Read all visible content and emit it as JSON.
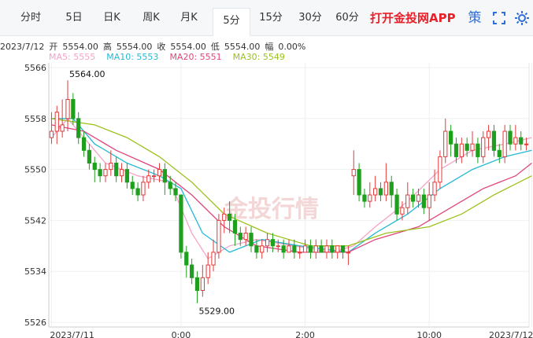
{
  "tabs": [
    {
      "label": "分时",
      "active": false
    },
    {
      "label": "5日",
      "active": false
    },
    {
      "label": "日K",
      "active": false
    },
    {
      "label": "周K",
      "active": false
    },
    {
      "label": "月K",
      "active": false
    },
    {
      "label": "5分",
      "active": true
    },
    {
      "label": "15分",
      "active": false
    },
    {
      "label": "30分",
      "active": false
    },
    {
      "label": "60分",
      "active": false
    }
  ],
  "app_cta": "打开金投网APP",
  "toolbar": {
    "strategy_label": "策",
    "icons": [
      "fullscreen-icon",
      "settings-icon"
    ]
  },
  "info": {
    "date": "2023/7/12",
    "open_label": "开",
    "open": "5554.00",
    "high_label": "高",
    "high": "5554.00",
    "close_label": "收",
    "close": "5554.00",
    "low_label": "低",
    "low": "5554.00",
    "amp_label": "幅",
    "amp": "0.00%"
  },
  "ma_legend": [
    {
      "label": "MA5:",
      "value": "5555",
      "color": "#f5a3c7"
    },
    {
      "label": "MA10:",
      "value": "5553",
      "color": "#25b9d4"
    },
    {
      "label": "MA20:",
      "value": "5551",
      "color": "#e0457b"
    },
    {
      "label": "MA30:",
      "value": "5549",
      "color": "#9bc21c"
    }
  ],
  "watermark": "金投行情",
  "chart_data": {
    "type": "candlestick",
    "y_ticks": [
      5566,
      5558,
      5550,
      5542,
      5534,
      5526
    ],
    "ylim": [
      5526,
      5566
    ],
    "x_ticks": [
      {
        "label": "2023/7/11",
        "index": 0
      },
      {
        "label": "0:00",
        "index": 24
      },
      {
        "label": "2:00",
        "index": 47
      },
      {
        "label": "10:00",
        "index": 70
      },
      {
        "label": "2023/7/12",
        "index": 89
      }
    ],
    "annotations": [
      {
        "text": "5564.00",
        "index": 3,
        "value": 5564,
        "position": "above"
      },
      {
        "text": "5529.00",
        "index": 27,
        "value": 5529,
        "position": "below"
      }
    ],
    "up_color": "#e23a3a",
    "down_color": "#1ea01e",
    "candles": [
      [
        5555,
        5556,
        5559,
        5554
      ],
      [
        5556,
        5559,
        5560,
        5554
      ],
      [
        5556,
        5557,
        5561,
        5555
      ],
      [
        5558,
        5561,
        5564,
        5556
      ],
      [
        5561,
        5558,
        5562,
        5557
      ],
      [
        5558,
        5555,
        5559,
        5554
      ],
      [
        5555,
        5553,
        5556,
        5552
      ],
      [
        5553,
        5551,
        5554,
        5550
      ],
      [
        5551,
        5550,
        5552,
        5548
      ],
      [
        5550,
        5549,
        5551,
        5548
      ],
      [
        5549,
        5550,
        5551,
        5548
      ],
      [
        5550,
        5551,
        5553,
        5549
      ],
      [
        5551,
        5549,
        5552,
        5548
      ],
      [
        5549,
        5550,
        5551,
        5548
      ],
      [
        5550,
        5548,
        5551,
        5547
      ],
      [
        5548,
        5547,
        5549,
        5546
      ],
      [
        5547,
        5546,
        5548,
        5545
      ],
      [
        5546,
        5548,
        5549,
        5545
      ],
      [
        5548,
        5549,
        5550,
        5547
      ],
      [
        5549,
        5549,
        5550,
        5548
      ],
      [
        5549,
        5550,
        5551,
        5548
      ],
      [
        5550,
        5548,
        5551,
        5546
      ],
      [
        5548,
        5547,
        5549,
        5546
      ],
      [
        5547,
        5546,
        5548,
        5545
      ],
      [
        5546,
        5537,
        5546,
        5536
      ],
      [
        5537,
        5535,
        5538,
        5533
      ],
      [
        5535,
        5533,
        5536,
        5532
      ],
      [
        5533,
        5531,
        5534,
        5529
      ],
      [
        5531,
        5533,
        5535,
        5530
      ],
      [
        5533,
        5535,
        5537,
        5532
      ],
      [
        5535,
        5537,
        5539,
        5534
      ],
      [
        5537,
        5542,
        5543,
        5536
      ],
      [
        5542,
        5543,
        5544,
        5540
      ],
      [
        5543,
        5542,
        5545,
        5540
      ],
      [
        5542,
        5540,
        5543,
        5538
      ],
      [
        5540,
        5539,
        5541,
        5538
      ],
      [
        5539,
        5540,
        5541,
        5538
      ],
      [
        5540,
        5538,
        5541,
        5537
      ],
      [
        5538,
        5537,
        5539,
        5536
      ],
      [
        5537,
        5538,
        5539,
        5536
      ],
      [
        5538,
        5539,
        5540,
        5537
      ],
      [
        5539,
        5538,
        5540,
        5537
      ],
      [
        5538,
        5538,
        5539,
        5537
      ],
      [
        5538,
        5537,
        5539,
        5536
      ],
      [
        5537,
        5538,
        5539,
        5537
      ],
      [
        5538,
        5537,
        5539,
        5536
      ],
      [
        5537,
        5537,
        5538,
        5536
      ],
      [
        5537,
        5538,
        5539,
        5537
      ],
      [
        5538,
        5537,
        5539,
        5536
      ],
      [
        5537,
        5538,
        5539,
        5536
      ],
      [
        5538,
        5537,
        5539,
        5537
      ],
      [
        5537,
        5538,
        5539,
        5536
      ],
      [
        5538,
        5537,
        5539,
        5536
      ],
      [
        5537,
        5538,
        5538,
        5536
      ],
      [
        5538,
        5537,
        5538,
        5536
      ],
      [
        5537,
        5537,
        5538,
        5535
      ],
      [
        5549,
        5550,
        5553,
        5546
      ],
      [
        5550,
        5546,
        5551,
        5545
      ],
      [
        5546,
        5545,
        5547,
        5544
      ],
      [
        5545,
        5546,
        5548,
        5544
      ],
      [
        5546,
        5547,
        5549,
        5545
      ],
      [
        5547,
        5546,
        5548,
        5545
      ],
      [
        5546,
        5548,
        5551,
        5545
      ],
      [
        5548,
        5546,
        5549,
        5544
      ],
      [
        5546,
        5543,
        5547,
        5542
      ],
      [
        5543,
        5544,
        5545,
        5542
      ],
      [
        5544,
        5546,
        5548,
        5543
      ],
      [
        5546,
        5545,
        5547,
        5544
      ],
      [
        5545,
        5546,
        5547,
        5544
      ],
      [
        5546,
        5544,
        5547,
        5543
      ],
      [
        5544,
        5546,
        5548,
        5542
      ],
      [
        5546,
        5548,
        5550,
        5545
      ],
      [
        5548,
        5552,
        5553,
        5547
      ],
      [
        5552,
        5556,
        5558,
        5551
      ],
      [
        5556,
        5554,
        5557,
        5552
      ],
      [
        5554,
        5552,
        5555,
        5551
      ],
      [
        5552,
        5554,
        5555,
        5551
      ],
      [
        5554,
        5553,
        5555,
        5552
      ],
      [
        5553,
        5554,
        5556,
        5552
      ],
      [
        5554,
        5552,
        5555,
        5551
      ],
      [
        5552,
        5555,
        5556,
        5551
      ],
      [
        5555,
        5556,
        5557,
        5553
      ],
      [
        5556,
        5553,
        5557,
        5552
      ],
      [
        5553,
        5552,
        5554,
        5551
      ],
      [
        5552,
        5556,
        5557,
        5551
      ],
      [
        5556,
        5554,
        5557,
        5553
      ],
      [
        5554,
        5555,
        5557,
        5553
      ],
      [
        5555,
        5554,
        5556,
        5553
      ],
      [
        5554,
        5554,
        5555,
        5553
      ]
    ],
    "ma": {
      "MA5": [
        [
          0,
          5555
        ],
        [
          3,
          5558
        ],
        [
          6,
          5555
        ],
        [
          10,
          5551
        ],
        [
          16,
          5549
        ],
        [
          22,
          5548
        ],
        [
          26,
          5540
        ],
        [
          29,
          5536
        ],
        [
          33,
          5538
        ],
        [
          38,
          5539
        ],
        [
          45,
          5538
        ],
        [
          52,
          5537
        ],
        [
          56,
          5538
        ],
        [
          60,
          5541
        ],
        [
          66,
          5545
        ],
        [
          72,
          5550
        ],
        [
          78,
          5553
        ],
        [
          84,
          5554
        ],
        [
          89,
          5555
        ]
      ],
      "MA10": [
        [
          0,
          5558
        ],
        [
          4,
          5558
        ],
        [
          8,
          5554
        ],
        [
          14,
          5551
        ],
        [
          20,
          5549
        ],
        [
          24,
          5547
        ],
        [
          28,
          5540
        ],
        [
          33,
          5537
        ],
        [
          39,
          5539
        ],
        [
          46,
          5538
        ],
        [
          55,
          5537
        ],
        [
          60,
          5540
        ],
        [
          66,
          5543
        ],
        [
          72,
          5547
        ],
        [
          78,
          5550
        ],
        [
          84,
          5552
        ],
        [
          89,
          5553
        ]
      ],
      "MA20": [
        [
          0,
          5557
        ],
        [
          6,
          5556
        ],
        [
          12,
          5553
        ],
        [
          20,
          5550
        ],
        [
          26,
          5546
        ],
        [
          32,
          5541
        ],
        [
          38,
          5538
        ],
        [
          46,
          5537
        ],
        [
          55,
          5537
        ],
        [
          60,
          5539
        ],
        [
          68,
          5541
        ],
        [
          74,
          5544
        ],
        [
          80,
          5547
        ],
        [
          86,
          5549
        ],
        [
          89,
          5551
        ]
      ],
      "MA30": [
        [
          0,
          5558
        ],
        [
          8,
          5557
        ],
        [
          14,
          5555
        ],
        [
          20,
          5552
        ],
        [
          26,
          5548
        ],
        [
          32,
          5543
        ],
        [
          40,
          5540
        ],
        [
          48,
          5538
        ],
        [
          55,
          5538
        ],
        [
          62,
          5540
        ],
        [
          70,
          5541
        ],
        [
          76,
          5543
        ],
        [
          82,
          5546
        ],
        [
          89,
          5549
        ]
      ]
    }
  }
}
